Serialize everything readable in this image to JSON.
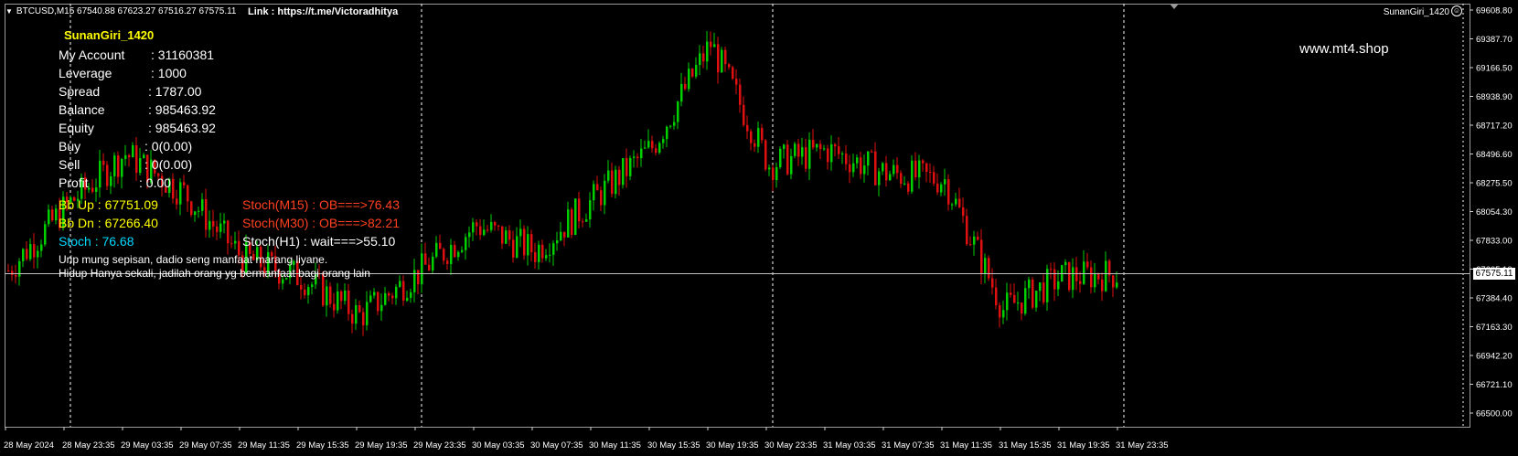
{
  "header": {
    "symbol_line": "BTCUSD,M15  67540.88 67623.27 67516.27 67575.11",
    "link": "Link : https://t.me/Victoradhitya",
    "indicator_name": "SunanGiri_1420",
    "site": "www.mt4.shop"
  },
  "panel": {
    "title": "SunanGiri_1420",
    "rows": [
      {
        "label": "My Account",
        "value": ": 31160381"
      },
      {
        "label": "Leverage",
        "value": ": 1000"
      },
      {
        "label": "Spread",
        "value": ": 1787.00"
      },
      {
        "label": "Balance",
        "value": ": 985463.92"
      },
      {
        "label": "Equity",
        "value": ": 985463.92"
      },
      {
        "label": "Buy",
        "value": ": 0(0.00)"
      },
      {
        "label": "Sell",
        "value": ": 0(0.00)"
      },
      {
        "label": "Profit",
        "value": ": 0.00"
      }
    ],
    "bb_up": "Bb Up : 67751.09",
    "bb_dn": "Bb Dn : 67266.40",
    "stoch": "Stoch : 76.68",
    "stoch_m15": "Stoch(M15) : OB===>76.43",
    "stoch_m30": "Stoch(M30) : OB===>82.21",
    "stoch_h1": "Stoch(H1) : wait===>55.10",
    "motto_1": "Urip mung sepisan, dadio seng manfaat marang liyane.",
    "motto_2": "Hidup Hanya sekali, jadilah orang yg bermanfaat bagi orang lain"
  },
  "colors": {
    "background": "#000000",
    "bull": "#00d000",
    "bear": "#e01010",
    "grid": "#ffffff",
    "bb_up": "#ffff00",
    "bb_dn": "#ffff00",
    "stoch": "#00d8ff",
    "stoch_m15": "#ff4020",
    "stoch_m30": "#ff4020",
    "stoch_h1": "#ffffff",
    "current_price_line": "#c0c0c0"
  },
  "price_axis": {
    "labels": [
      "69608.80",
      "69387.70",
      "69166.50",
      "68938.90",
      "68717.20",
      "68496.60",
      "68275.50",
      "68054.30",
      "67833.00",
      "67605.10",
      "67384.40",
      "67163.30",
      "66942.20",
      "66721.10",
      "66500.00"
    ],
    "current_price": "67575.11"
  },
  "time_axis": {
    "labels": [
      "28 May 2024",
      "28 May 23:35",
      "29 May 03:35",
      "29 May 07:35",
      "29 May 11:35",
      "29 May 15:35",
      "29 May 19:35",
      "29 May 23:35",
      "30 May 03:35",
      "30 May 07:35",
      "30 May 11:35",
      "30 May 15:35",
      "30 May 19:35",
      "30 May 23:35",
      "31 May 03:35",
      "31 May 07:35",
      "31 May 11:35",
      "31 May 15:35",
      "31 May 19:35",
      "31 May 23:35"
    ]
  },
  "chart_data": {
    "type": "candlestick",
    "symbol": "BTCUSD",
    "timeframe": "M15",
    "ylim": [
      66500.0,
      69608.8
    ],
    "current_price": 67575.11,
    "close_path": [
      {
        "t": "28 May 2024",
        "close": 67600
      },
      {
        "t": "28 May 23:35",
        "close": 68100
      },
      {
        "t": "29 May 03:35",
        "close": 68500
      },
      {
        "t": "29 May 07:35",
        "close": 68200
      },
      {
        "t": "29 May 11:35",
        "close": 67700
      },
      {
        "t": "29 May 15:35",
        "close": 67550
      },
      {
        "t": "29 May 19:35",
        "close": 67250
      },
      {
        "t": "29 May 23:35",
        "close": 67580
      },
      {
        "t": "30 May 03:35",
        "close": 67950
      },
      {
        "t": "30 May 07:35",
        "close": 67750
      },
      {
        "t": "30 May 11:35",
        "close": 68150
      },
      {
        "t": "30 May 15:35",
        "close": 68550
      },
      {
        "t": "30 May 19:35",
        "close": 69350
      },
      {
        "t": "30 May 23:35",
        "close": 68420
      },
      {
        "t": "31 May 03:35",
        "close": 68530
      },
      {
        "t": "31 May 07:35",
        "close": 68350
      },
      {
        "t": "31 May 11:35",
        "close": 68300
      },
      {
        "t": "31 May 15:35",
        "close": 67300
      },
      {
        "t": "31 May 19:35",
        "close": 67550
      },
      {
        "t": "31 May 23:35",
        "close": 67575
      }
    ]
  }
}
